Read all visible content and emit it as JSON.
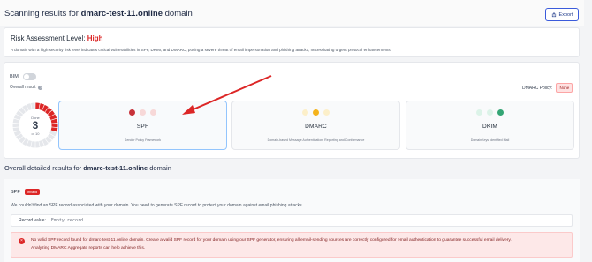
{
  "header": {
    "title_prefix": "Scanning results for",
    "domain": "dmarc-test-11.online",
    "title_suffix": "domain",
    "export_label": "Export"
  },
  "risk": {
    "label": "Risk Assessment Level:",
    "level": "High",
    "description": "A domain with a high security risk level indicates critical vulnerabilities in SPF, DKIM, and DMARC, posing a severe threat of email impersonation and phishing attacks, necessitating urgent protocol enhancements."
  },
  "controls": {
    "bimi_label": "BIMI",
    "overall_result_label": "Overall result",
    "dmarc_policy_label": "DMARC Policy:",
    "dmarc_policy_value": "None"
  },
  "gauge": {
    "done_label": "Done",
    "value": 3,
    "total_label": "of 10",
    "total": 10
  },
  "protocols": [
    {
      "name": "SPF",
      "subtitle": "Sender Policy Framework",
      "dots": [
        "#c7323a",
        "#f7d8d8",
        "#f7d8d8"
      ],
      "selected": true
    },
    {
      "name": "DMARC",
      "subtitle": "Domain-based Message Authentication, Reporting and Conformance",
      "dots": [
        "#fcefc9",
        "#f4b31c",
        "#fcefc9"
      ],
      "selected": false
    },
    {
      "name": "DKIM",
      "subtitle": "DomainKeys Identified Mail",
      "dots": [
        "#dcf3e8",
        "#dcf3e8",
        "#34a574"
      ],
      "selected": false
    }
  ],
  "details": {
    "title_prefix": "Overall detailed results for",
    "domain": "dmarc-test-11.online",
    "title_suffix": "domain",
    "spf_label": "SPF",
    "status_badge": "Invalid",
    "description": "We couldn't find an SPF record associated with your domain. You need to generate SPF record to protect your domain against email phishing attacks.",
    "record_label": "Record value:",
    "record_value": "Empty record",
    "error_line1": "No valid SPF record found for dmarc-test-11.online domain. Create a valid SPF record for your domain using our SPF generator, ensuring all email-sending sources are correctly configured for email authentication to guarantee successful email delivery.",
    "error_line2": "Analyzing DMARC Aggregate reports can help achieve this."
  },
  "colors": {
    "accent": "#3b5bdb",
    "danger": "#dc2626",
    "warning": "#f4b31c",
    "success": "#34a574"
  }
}
